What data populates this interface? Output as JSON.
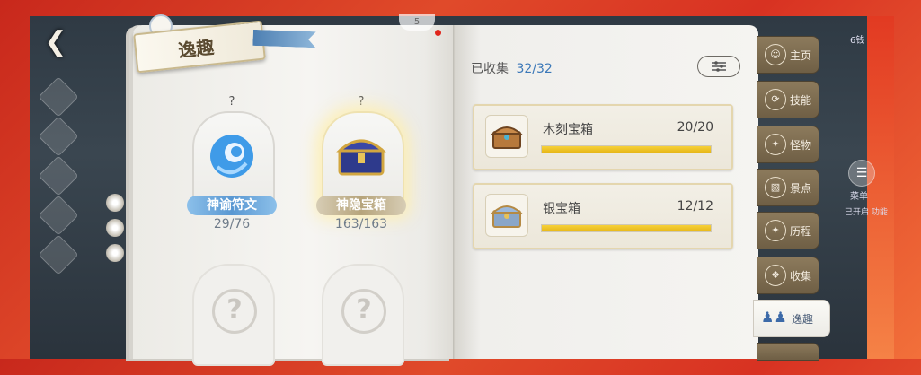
{
  "header": {
    "title": "逸趣",
    "badge": "5"
  },
  "left_page": {
    "cards": [
      {
        "question": "?",
        "name": "神谕符文",
        "count": "29/76",
        "name_color": "#6aa3d6"
      },
      {
        "question": "?",
        "name": "神隐宝箱",
        "count": "163/163",
        "name_color": "#c4b592"
      },
      {
        "question": "?"
      },
      {
        "question": "?"
      }
    ]
  },
  "right_page": {
    "collected_label": "已收集",
    "collected_value": "32/32",
    "filter_icon": "filter-sliders-icon",
    "chests": [
      {
        "name": "木刻宝箱",
        "progress_text": "20/20",
        "progress": 1.0
      },
      {
        "name": "银宝箱",
        "progress_text": "12/12",
        "progress": 1.0
      }
    ]
  },
  "tabs": [
    {
      "label": "主页",
      "icon": "user-icon"
    },
    {
      "label": "技能",
      "icon": "swirl-icon"
    },
    {
      "label": "怪物",
      "icon": "wing-icon"
    },
    {
      "label": "景点",
      "icon": "pillar-icon"
    },
    {
      "label": "历程",
      "icon": "wing-icon"
    },
    {
      "label": "收集",
      "icon": "collect-icon"
    },
    {
      "label": "逸趣",
      "icon": "people-icon",
      "active": true
    }
  ],
  "scene": {
    "right_top_label": "6钱",
    "menu_label": "菜单",
    "open_label": "已开启 功能"
  },
  "colors": {
    "accent_blue": "#3b78b8",
    "progress_yellow": "#f0c72a",
    "tab_brown": "#7e6c50",
    "background_red": "#d83222"
  }
}
